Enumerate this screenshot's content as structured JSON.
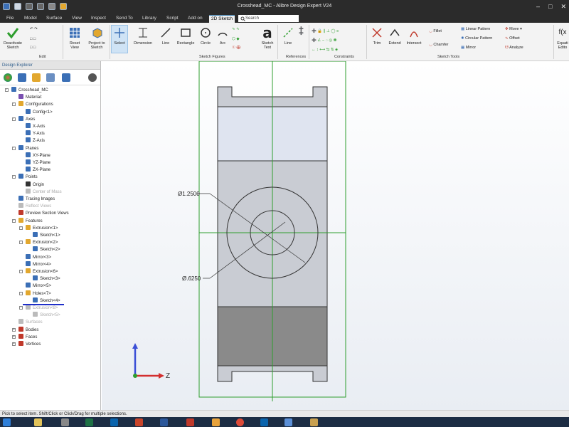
{
  "window": {
    "title": "Crosshead_MC - Alibre Design Expert V24"
  },
  "menu": {
    "tabs": [
      "File",
      "Model",
      "Surface",
      "View",
      "Inspect",
      "Send To",
      "Library",
      "Script",
      "Add on",
      "2D Sketch"
    ],
    "active_tab": "2D Sketch",
    "search_placeholder": "Search"
  },
  "ribbon": {
    "deactivate_label": "Deactivate Sketch",
    "reset_view_label": "Reset View",
    "project_label": "Project to Sketch",
    "select_label": "Select",
    "dimension_label": "Dimension",
    "line_label": "Line",
    "rectangle_label": "Rectangle",
    "circle_label": "Circle",
    "arc_label": "Arc",
    "sketch_text_label": "Sketch Text",
    "ref_line_label": "Line",
    "trim_label": "Trim",
    "extend_label": "Extend",
    "intersect_label": "Intersect",
    "fillet_label": "Fillet",
    "chamfer_label": "Chamfer",
    "linear_pattern_label": "Linear Pattern",
    "circular_pattern_label": "Circular Pattern",
    "mirror_label": "Mirror",
    "move_label": "Move",
    "offset_label": "Offset",
    "analyze_label": "Analyze",
    "equation_label": "Equati Edito",
    "groups": {
      "edit": "Edit",
      "sketch_figures": "Sketch Figures",
      "references": "References",
      "constraints": "Constraints",
      "sketch_tools": "Sketch Tools"
    }
  },
  "explorer": {
    "title": "Design Explorer",
    "tree": [
      {
        "label": "Crosshead_MC",
        "color": "#3b6fb6"
      },
      {
        "label": "Material:",
        "color": "#7a4fb0"
      },
      {
        "label": "Configurations",
        "color": "#e2a72e"
      },
      {
        "label": "Config<1>",
        "color": "#3b6fb6"
      },
      {
        "label": "Axes",
        "color": "#3b6fb6"
      },
      {
        "label": "X-Axis",
        "color": "#3b6fb6"
      },
      {
        "label": "Y-Axis",
        "color": "#3b6fb6"
      },
      {
        "label": "Z-Axis",
        "color": "#3b6fb6"
      },
      {
        "label": "Planes",
        "color": "#3b6fb6"
      },
      {
        "label": "XY-Plane",
        "color": "#3b6fb6"
      },
      {
        "label": "YZ-Plane",
        "color": "#3b6fb6"
      },
      {
        "label": "ZX-Plane",
        "color": "#3b6fb6"
      },
      {
        "label": "Points",
        "color": "#3b6fb6"
      },
      {
        "label": "Origin",
        "color": "#333333"
      },
      {
        "label": "Center of Mass",
        "color": "#bbbbbb"
      },
      {
        "label": "Tracing Images",
        "color": "#3b6fb6"
      },
      {
        "label": "Reflect Views",
        "color": "#bbbbbb"
      },
      {
        "label": "Preview Section Views",
        "color": "#c0392b"
      },
      {
        "label": "Features",
        "color": "#e2a72e"
      },
      {
        "label": "Extrusion<1>",
        "color": "#e2a72e"
      },
      {
        "label": "Sketch<1>",
        "color": "#3b6fb6"
      },
      {
        "label": "Extrusion<2>",
        "color": "#e2a72e"
      },
      {
        "label": "Sketch<2>",
        "color": "#3b6fb6"
      },
      {
        "label": "Mirror<3>",
        "color": "#3b6fb6"
      },
      {
        "label": "Mirror<4>",
        "color": "#3b6fb6"
      },
      {
        "label": "Extrusion<6>",
        "color": "#e2a72e"
      },
      {
        "label": "Sketch<3>",
        "color": "#3b6fb6"
      },
      {
        "label": "Mirror<5>",
        "color": "#3b6fb6"
      },
      {
        "label": "Holes<7>",
        "color": "#e2a72e"
      },
      {
        "label": "Sketch<4>",
        "color": "#3b6fb6"
      },
      {
        "label": "Extrusion<8>",
        "color": "#bbbbbb"
      },
      {
        "label": "Sketch<5>",
        "color": "#bbbbbb"
      },
      {
        "label": "Surfaces",
        "color": "#bbbbbb"
      },
      {
        "label": "Bodies",
        "color": "#c0392b"
      },
      {
        "label": "Faces",
        "color": "#c0392b"
      },
      {
        "label": "Vertices",
        "color": "#c0392b"
      }
    ]
  },
  "canvas": {
    "dim_outer": "Ø1.2500",
    "dim_inner": "Ø.6250",
    "axis_z": "Z"
  },
  "status": {
    "text": "Pick to select item. Shift/Click or Click/Drag for multiple selections."
  },
  "colors": {
    "accent": "#3c7fb1",
    "sketch_green": "#2e9e2e",
    "body_fill": "#c9ccd3",
    "face_light": "#dfe4f0",
    "face_dark": "#8a8a8a"
  }
}
